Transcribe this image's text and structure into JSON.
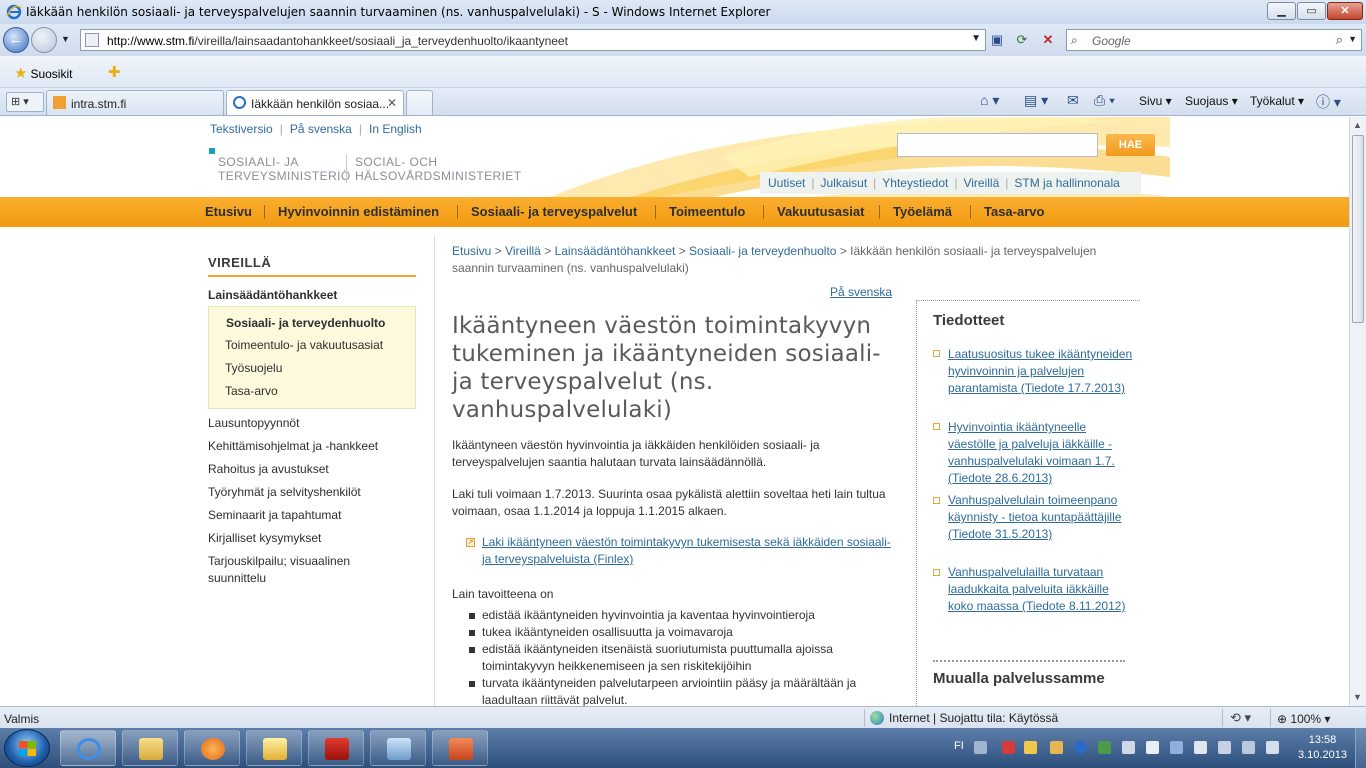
{
  "window": {
    "title": "Iäkkään henkilön sosiaali- ja terveyspalvelujen saannin turvaaminen (ns. vanhuspalvelulaki) - S - Windows Internet Explorer",
    "min_glyph": "▁",
    "max_glyph": "▭",
    "close_glyph": "✕"
  },
  "browser": {
    "url_host": "http://www.stm.fi",
    "url_path": "/vireilla/lainsaadantohankkeet/sosiaali_ja_terveydenhuolto/ikaantyneet",
    "search_placeholder": "Google",
    "favorites_label": "Suosikit",
    "tabs": [
      {
        "label": "intra.stm.fi"
      },
      {
        "label": "Iäkkään henkilön sosiaa..."
      }
    ],
    "commands": {
      "page": "Sivu",
      "safety": "Suojaus",
      "tools": "Työkalut"
    },
    "status": "Valmis",
    "zone": "Internet | Suojattu tila: Käytössä",
    "zoom": "100%"
  },
  "site": {
    "lang_links": [
      "Tekstiversio",
      "På svenska",
      "In English"
    ],
    "logo_fi": [
      "SOSIAALI- JA",
      "TERVEYSMINISTERIÖ"
    ],
    "logo_sv": [
      "SOCIAL- OCH",
      "HÄLSOVÅRDSMINISTERIET"
    ],
    "search_button": "HAE",
    "util_links": [
      "Uutiset",
      "Julkaisut",
      "Yhteystiedot",
      "Vireillä",
      "STM ja hallinnonala"
    ],
    "main_nav": [
      "Etusivu",
      "Hyvinvoinnin edistäminen",
      "Sosiaali- ja terveyspalvelut",
      "Toimeentulo",
      "Vakuutusasiat",
      "Työelämä",
      "Tasa-arvo"
    ]
  },
  "sidebar": {
    "heading": "VIREILLÄ",
    "section": "Lainsäädäntöhankkeet",
    "sub_items": [
      "Sosiaali- ja terveydenhuolto",
      "Toimeentulo- ja vakuutusasiat",
      "Työsuojelu",
      "Tasa-arvo"
    ],
    "items": [
      "Lausuntopyynnöt",
      "Kehittämisohjelmat ja -hankkeet",
      "Rahoitus ja avustukset",
      "Työryhmät ja selvityshenkilöt",
      "Seminaarit ja tapahtumat",
      "Kirjalliset kysymykset",
      "Tarjouskilpailu; visuaalinen suunnittelu"
    ]
  },
  "breadcrumb": {
    "links": [
      "Etusivu",
      "Vireillä",
      "Lainsäädäntöhankkeet",
      "Sosiaali- ja terveydenhuolto"
    ],
    "sep": ">",
    "current": "Iäkkään henkilön sosiaali- ja terveyspalvelujen saannin turvaaminen (ns. vanhuspalvelulaki)"
  },
  "article": {
    "lang_link": "På svenska",
    "title": "Ikääntyneen väestön toimintakyvyn tukeminen ja ikääntyneiden sosiaali- ja terveyspalvelut (ns. vanhuspalvelulaki)",
    "para1": "Ikääntyneen väestön hyvinvointia ja iäkkäiden henkilöiden sosiaali- ja terveyspalvelujen saantia halutaan turvata lainsäädännöllä.",
    "para2": "Laki tuli voimaan 1.7.2013. Suurinta osaa pykälistä alettiin soveltaa heti lain tultua voimaan, osaa 1.1.2014 ja loppuja 1.1.2015 alkaen.",
    "finlex_link": "Laki ikääntyneen väestön toimintakyvyn tukemisesta sekä iäkkäiden sosiaali- ja terveyspalveluista (Finlex)",
    "goals_heading": "Lain tavoitteena on",
    "goals": [
      "edistää ikääntyneiden hyvinvointia ja kaventaa hyvinvointieroja",
      "tukea ikääntyneiden osallisuutta ja voimavaroja",
      "edistää ikääntyneiden itsenäistä suoriutumista puuttumalla ajoissa toimintakyvyn heikkenemiseen ja sen riskitekijöihin",
      "turvata ikääntyneiden palvelutarpeen arviointiin pääsy ja määrältään ja laadultaan riittävät palvelut."
    ]
  },
  "right": {
    "heading": "Tiedotteet",
    "news": [
      "Laatusuositus tukee ikääntyneiden hyvinvoinnin ja palvelujen parantamista (Tiedote 17.7.2013)",
      "Hyvinvointia ikääntyneelle väestölle ja palveluja iäkkäille - vanhuspalvelulaki voimaan 1.7. (Tiedote 28.6.2013)",
      "Vanhuspalvelulain toimeenpano käynnisty - tietoa kuntapäättäjille (Tiedote 31.5.2013)",
      "Vanhuspalvelulailla turvataan laadukkaita palveluita iäkkäille koko maassa (Tiedote 8.11.2012)"
    ],
    "more_heading": "Muualla palvelussamme"
  },
  "taskbar": {
    "lang": "FI",
    "time": "13:58",
    "date": "3.10.2013"
  },
  "colors": {
    "accent_orange": "#f6a623",
    "link_blue": "#2f6c9b"
  }
}
